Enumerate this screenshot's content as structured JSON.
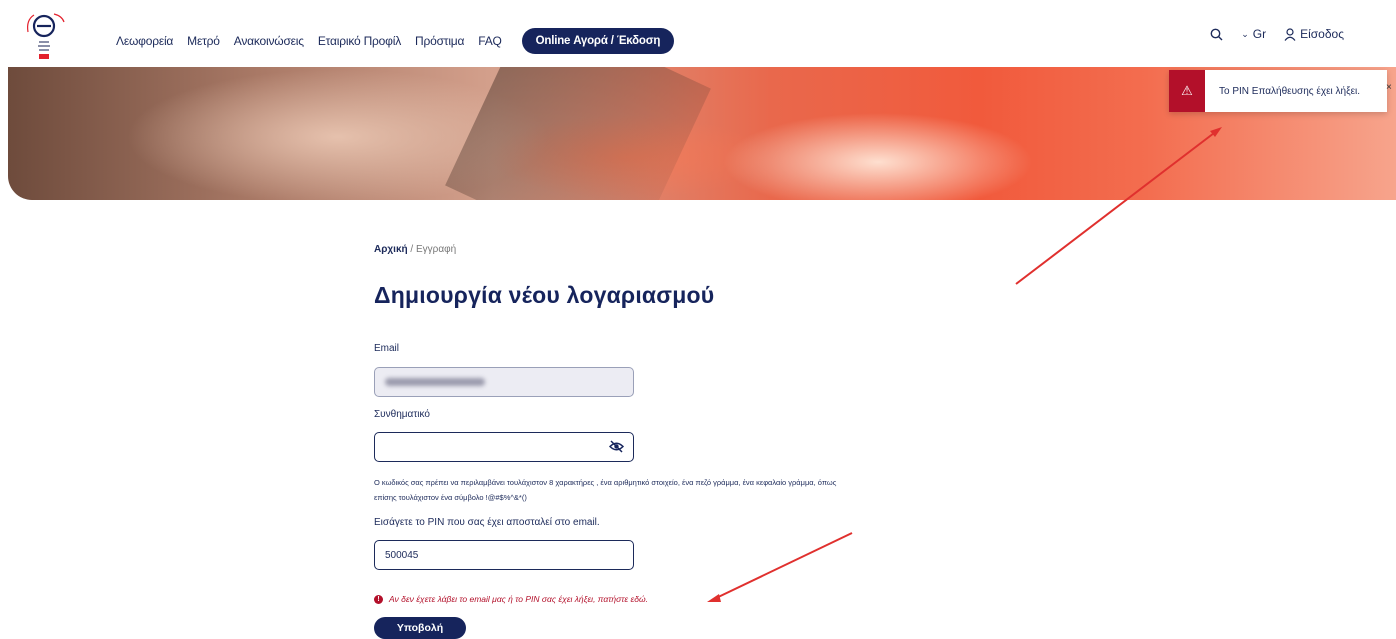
{
  "nav": {
    "items": [
      "Λεωφορεία",
      "Μετρό",
      "Ανακοινώσεις",
      "Εταιρικό Προφίλ",
      "Πρόστιμα",
      "FAQ"
    ],
    "cta": "Online Αγορά / Έκδοση",
    "language": "Gr",
    "login": "Είσοδος"
  },
  "toast": {
    "message": "Το PIN Επαλήθευσης έχει λήξει.",
    "close": "×"
  },
  "breadcrumb": {
    "home": "Αρχική",
    "current": "Εγγραφή"
  },
  "page": {
    "title": "Δημιουργία νέου λογαριασμού"
  },
  "form": {
    "email_label": "Email",
    "password_label": "Συνθηματικό",
    "password_hint": "Ο κωδικός σας πρέπει να περιλαμβάνει τουλάχιστον 8 χαρακτήρες , ένα αριθμητικό στοιχείο, ένα πεζό γράμμα, ένα κεφαλαίο γράμμα, όπως επίσης τουλάχιστον ένα σύμβολο !@#$%^&*()",
    "pin_label": "Εισάγετε το PIN που σας έχει αποσταλεί στο email.",
    "pin_value": "500045",
    "error_message": "Αν δεν έχετε λάβει το email μας ή το PIN σας έχει λήξει, πατήστε εδώ.",
    "submit_label": "Υποβολή"
  },
  "colors": {
    "navy": "#16245c",
    "alert": "#b3102a"
  }
}
